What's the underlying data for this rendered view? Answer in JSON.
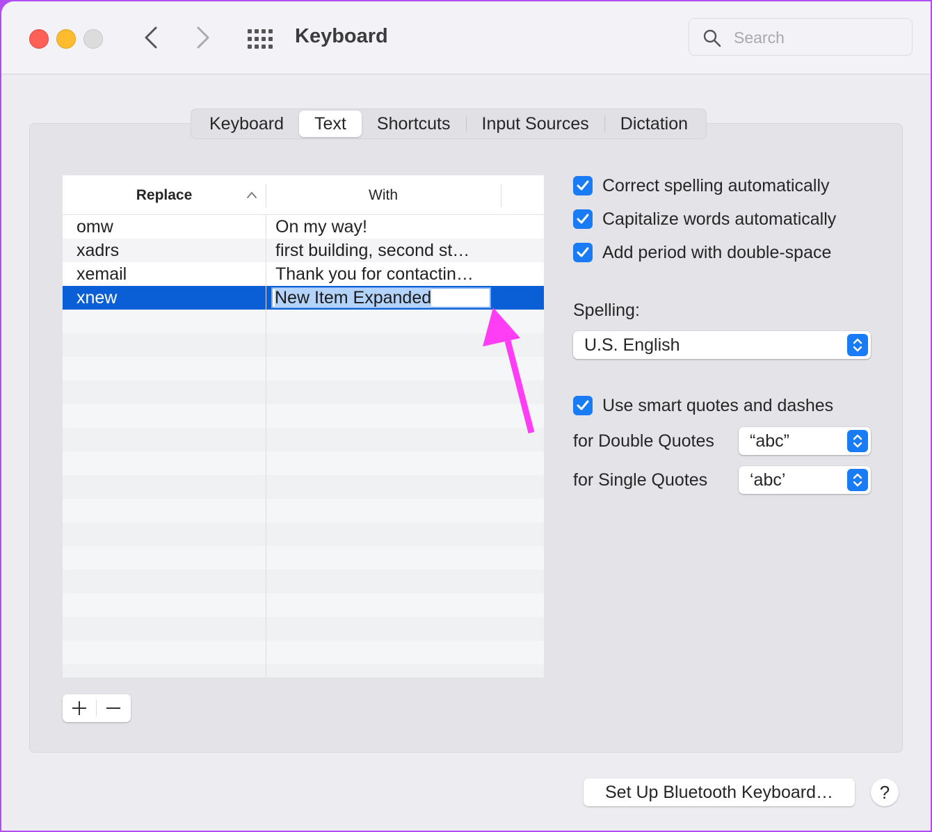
{
  "window": {
    "title": "Keyboard",
    "search_placeholder": "Search",
    "search_value": ""
  },
  "tabs": [
    {
      "label": "Keyboard",
      "active": false
    },
    {
      "label": "Text",
      "active": true
    },
    {
      "label": "Shortcuts",
      "active": false
    },
    {
      "label": "Input Sources",
      "active": false
    },
    {
      "label": "Dictation",
      "active": false
    }
  ],
  "replacements": {
    "columns": {
      "replace": "Replace",
      "with": "With"
    },
    "sort": {
      "column": "Replace",
      "direction": "ascending"
    },
    "rows": [
      {
        "replace": "omw",
        "with": "On my way!"
      },
      {
        "replace": "xadrs",
        "with": "first building, second st…"
      },
      {
        "replace": "xemail",
        "with": "Thank you for contactin…"
      },
      {
        "replace": "xnew",
        "with": "New Item Expanded",
        "selected": true,
        "editing": true
      }
    ],
    "add_label": "+",
    "remove_label": "−"
  },
  "options": {
    "correct_spelling": {
      "label": "Correct spelling automatically",
      "checked": true
    },
    "capitalize_words": {
      "label": "Capitalize words automatically",
      "checked": true
    },
    "add_period": {
      "label": "Add period with double-space",
      "checked": true
    },
    "spelling_label": "Spelling:",
    "spelling_value": "U.S. English",
    "smart_quotes": {
      "label": "Use smart quotes and dashes",
      "checked": true
    },
    "double_quotes_label": "for Double Quotes",
    "double_quotes_value": "“abc”",
    "single_quotes_label": "for Single Quotes",
    "single_quotes_value": "‘abc’"
  },
  "footer": {
    "setup_bluetooth_label": "Set Up Bluetooth Keyboard…",
    "help_label": "?"
  },
  "colors": {
    "accent": "#1a7cf5",
    "selection": "#0a5fd7",
    "annotation": "#ff3df5"
  }
}
